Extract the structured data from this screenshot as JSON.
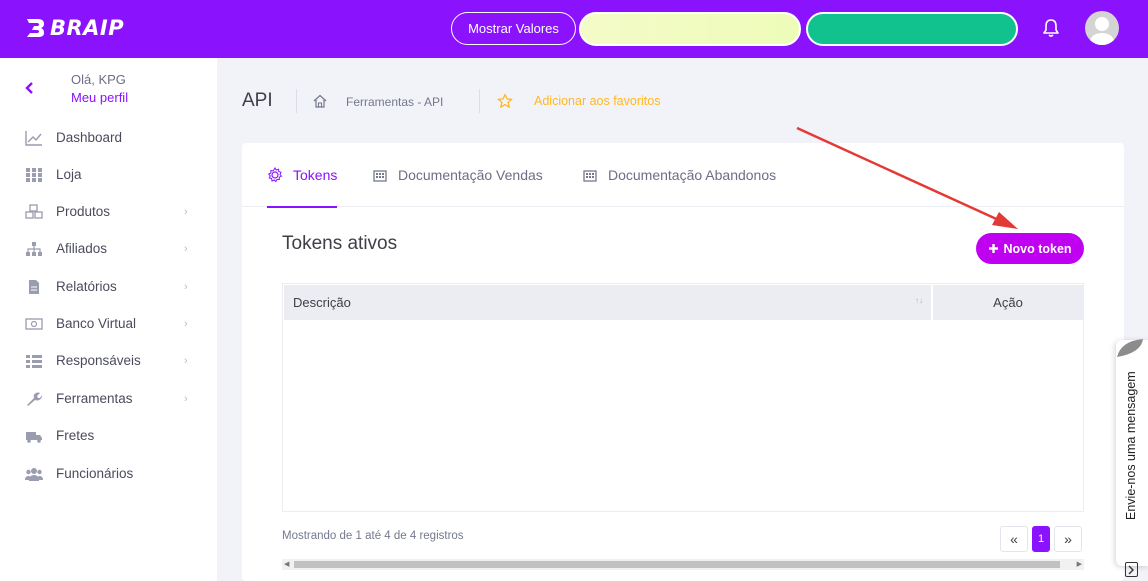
{
  "brand": {
    "name": "BRAIP"
  },
  "topbar": {
    "show_values_label": "Mostrar Valores"
  },
  "sidebar": {
    "greeting": "Olá, KPG",
    "profile_link": "Meu perfil",
    "items": [
      {
        "label": "Dashboard",
        "icon": "chart-line-icon",
        "has_submenu": false
      },
      {
        "label": "Loja",
        "icon": "grid-icon",
        "has_submenu": false
      },
      {
        "label": "Produtos",
        "icon": "boxes-icon",
        "has_submenu": true
      },
      {
        "label": "Afiliados",
        "icon": "sitemap-icon",
        "has_submenu": true
      },
      {
        "label": "Relatórios",
        "icon": "file-icon",
        "has_submenu": true
      },
      {
        "label": "Banco Virtual",
        "icon": "money-icon",
        "has_submenu": true
      },
      {
        "label": "Responsáveis",
        "icon": "list-icon",
        "has_submenu": true
      },
      {
        "label": "Ferramentas",
        "icon": "wrench-icon",
        "has_submenu": true
      },
      {
        "label": "Fretes",
        "icon": "truck-icon",
        "has_submenu": false
      },
      {
        "label": "Funcionários",
        "icon": "users-icon",
        "has_submenu": false
      }
    ]
  },
  "subheader": {
    "title": "API",
    "breadcrumb": "Ferramentas - API",
    "favorite_label": "Adicionar aos favoritos"
  },
  "tabs": [
    {
      "label": "Tokens",
      "icon": "gear-icon",
      "active": true
    },
    {
      "label": "Documentação Vendas",
      "icon": "building-icon",
      "active": false
    },
    {
      "label": "Documentação Abandonos",
      "icon": "building-icon",
      "active": false
    }
  ],
  "main": {
    "section_title": "Tokens ativos",
    "new_token_label": "Novo token",
    "table": {
      "columns": [
        "Descrição",
        "Ação"
      ],
      "rows": []
    },
    "info": "Mostrando de 1 até 4 de 4 registros",
    "pagination": {
      "prev": "«",
      "current": "1",
      "next": "»"
    }
  },
  "chat_widget": {
    "label": "Envie-nos uma mensagem"
  },
  "colors": {
    "brand_purple": "#8a12fd",
    "button_magenta": "#c000f0",
    "favorite_yellow": "#ffb822",
    "annotation_red": "#e53935"
  }
}
